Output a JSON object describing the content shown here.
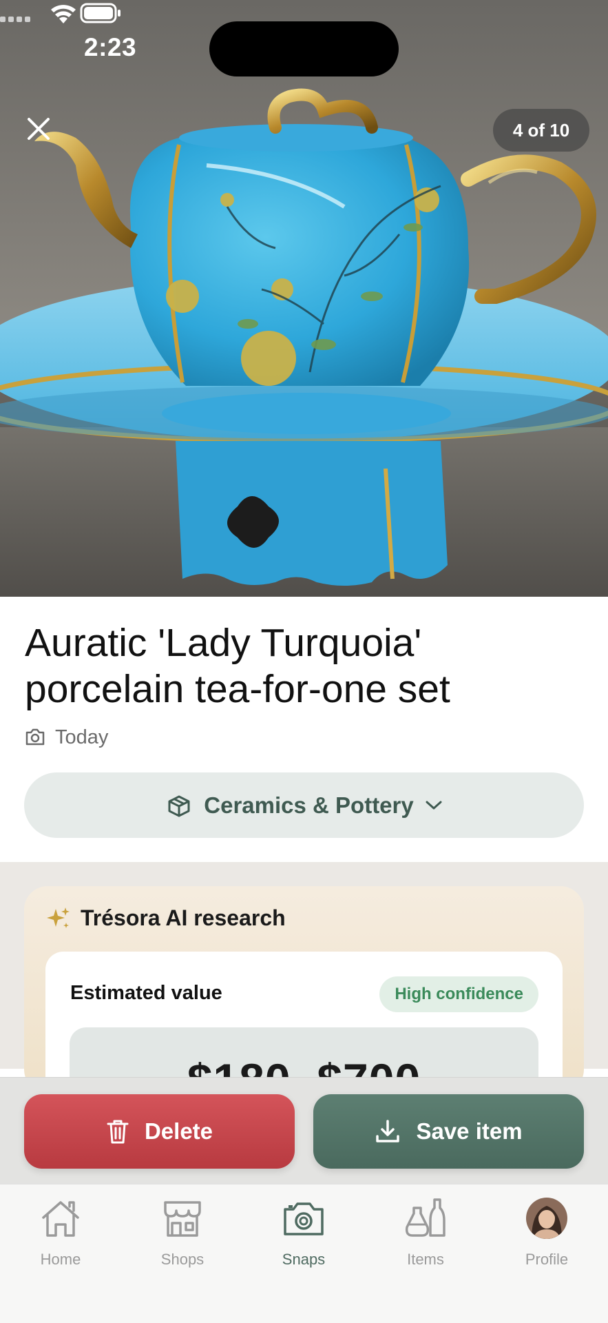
{
  "status_bar": {
    "time": "2:23"
  },
  "viewer": {
    "counter": "4 of 10",
    "close_icon": "close-icon"
  },
  "item": {
    "title": "Auratic 'Lady Turquoia' porcelain tea-for-one set",
    "captured": "Today",
    "category": "Ceramics & Pottery"
  },
  "research": {
    "heading": "Trésora AI research",
    "estimated_label": "Estimated value",
    "confidence": "High confidence",
    "price_range": "$180–$700"
  },
  "actions": {
    "delete_label": "Delete",
    "save_label": "Save item"
  },
  "tabs": [
    {
      "label": "Home",
      "icon": "home-icon"
    },
    {
      "label": "Shops",
      "icon": "shop-icon"
    },
    {
      "label": "Snaps",
      "icon": "camera-icon",
      "active": true
    },
    {
      "label": "Items",
      "icon": "vases-icon"
    },
    {
      "label": "Profile",
      "icon": "avatar"
    }
  ],
  "colors": {
    "accent_green": "#4f6b61",
    "delete_red": "#c8474d",
    "confidence_green": "#3a8a5a",
    "category_bg": "#e6ebe9"
  }
}
